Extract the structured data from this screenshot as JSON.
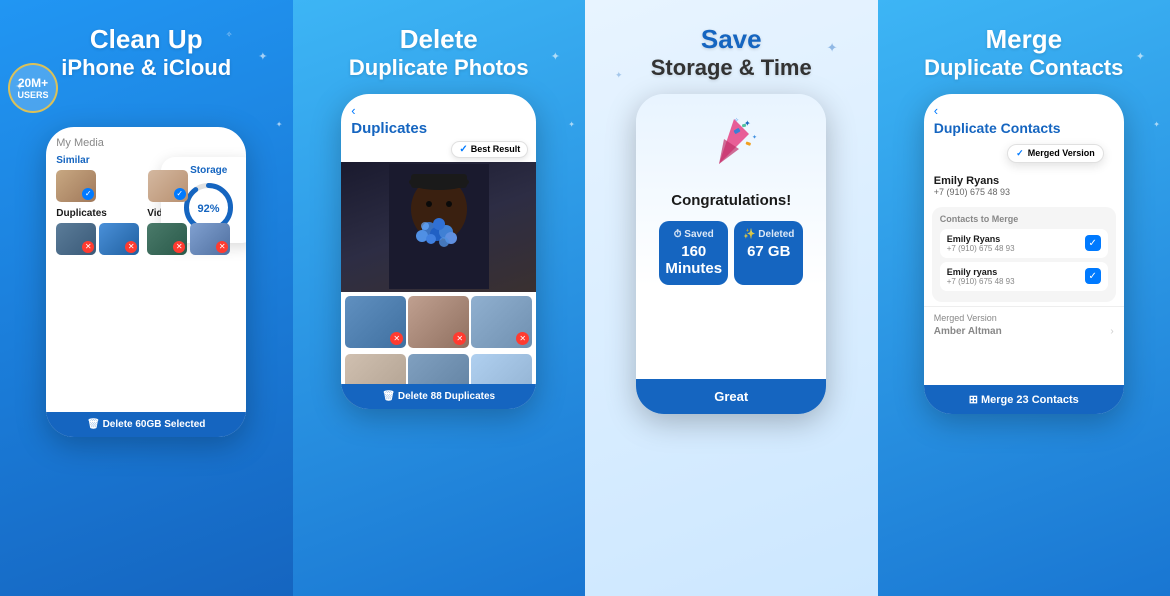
{
  "panel1": {
    "title_line1": "Clean Up",
    "title_line2": "iPhone & iCloud",
    "badge_num": "20M+",
    "badge_label": "USERS",
    "storage_label": "Storage",
    "storage_pct": "92%",
    "my_media": "My Media",
    "similar_label": "Similar",
    "duplicates_label": "Duplicates",
    "videos_label": "Videos",
    "bottom_bar": "🗑  Delete 60GB Selected"
  },
  "panel2": {
    "title_line1": "Delete",
    "title_line2": "Duplicate Photos",
    "screen_title": "Duplicates",
    "best_result": "Best Result",
    "bottom_bar": "🗑  Delete 88 Duplicates"
  },
  "panel3": {
    "title_line1": "Save",
    "title_line2": "Storage & Time",
    "congrats": "Congratulations!",
    "saved_label": "⏱ Saved",
    "saved_value": "160 Minutes",
    "deleted_label": "✨ Deleted",
    "deleted_value": "67 GB",
    "bottom_btn": "Great"
  },
  "panel4": {
    "title_line1": "Merge",
    "title_line2": "Duplicate Contacts",
    "screen_title": "Duplicate Contacts",
    "merged_badge": "Merged Version",
    "contact_name": "Emily Ryans",
    "contact_phone": "+7 (910) 675 48 93",
    "ctm_title": "Contacts to Merge",
    "ctm1_name": "Emily Ryans",
    "ctm1_phone": "+7 (910) 675 48 93",
    "ctm2_name": "Emily ryans",
    "ctm2_phone": "+7 (910) 675 48 93",
    "mv_label": "Merged Version",
    "mv_name": "Amber Altman",
    "bottom_bar": "⊞  Merge 23 Contacts"
  }
}
